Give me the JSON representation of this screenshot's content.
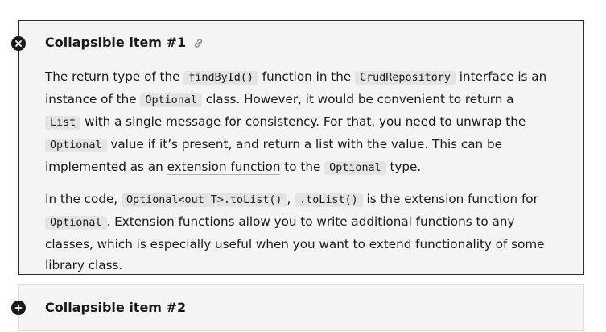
{
  "items": [
    {
      "title": "Collapsible item #1",
      "paragraph1": {
        "t1": "The return type of the ",
        "c1": "findById()",
        "t2": " function in the ",
        "c2": "CrudRepository",
        "t3": " interface is an instance of the ",
        "c3": "Optional",
        "t4": " class. However, it would be convenient to return a ",
        "c4": "List",
        "t5": " with a single message for consistency. For that, you need to unwrap the ",
        "c5": "Optional",
        "t6": " value if it’s present, and return a list with the value. This can be implemented as an ",
        "link": "extension function",
        "t7": " to the ",
        "c6": "Optional",
        "t8": " type."
      },
      "paragraph2": {
        "t1": "In the code, ",
        "c1": "Optional<out T>.toList()",
        "t2": ", ",
        "c2": ".toList()",
        "t3": " is the extension function for ",
        "c3": "Optional",
        "t4": ". Extension functions allow you to write additional functions to any classes, which is especially useful when you want to extend functionality of some library class."
      }
    },
    {
      "title": "Collapsible item #2"
    }
  ],
  "icons": {
    "item1_toggle": "close-circle-icon",
    "item1_anchor": "link-icon",
    "item2_toggle": "plus-circle-icon"
  },
  "colors": {
    "panel_bg": "#f4f4f4",
    "code_bg": "#e4e4e5",
    "text": "#19191c",
    "expanded_border": "#2b2b2d",
    "collapsed_border": "#dcdcde"
  }
}
